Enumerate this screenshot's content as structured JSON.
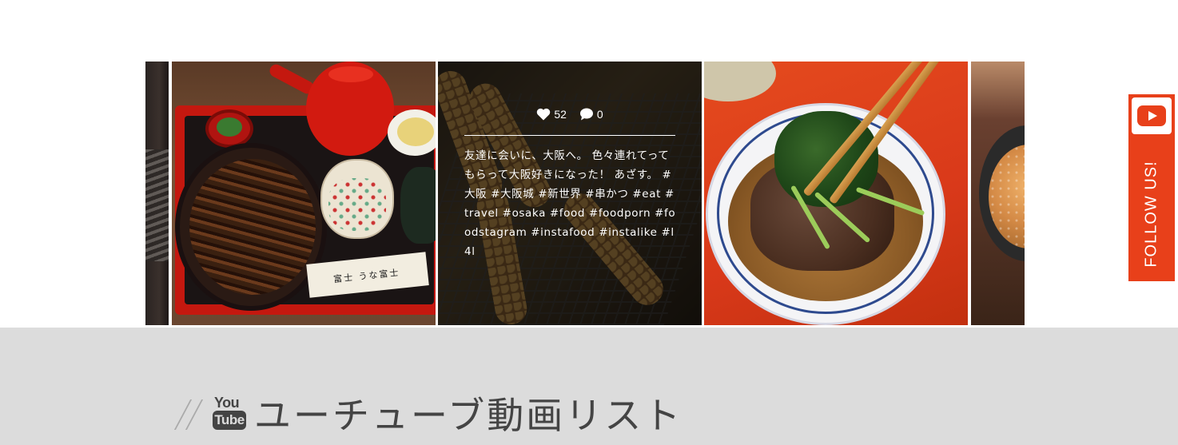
{
  "instagram": {
    "featured_post": {
      "likes": "52",
      "comments": "0",
      "caption": "友達に会いに、大阪へ。 色々連れてってもらって大阪好きになった！ あざす。 #大阪 #大阪城 #新世界 #串かつ #eat #travel #osaka #food #foodporn #foodstagram #instafood #instalike #l4l"
    },
    "menu_card_text": "富士 うな富士"
  },
  "follow_tab": {
    "label": "FOLLOW US!",
    "icon": "youtube-icon",
    "color": "#e8401a"
  },
  "youtube_section": {
    "logo_top": "You",
    "logo_bottom": "Tube",
    "title": "ユーチューブ動画リスト",
    "background": "#dcdcdc"
  }
}
